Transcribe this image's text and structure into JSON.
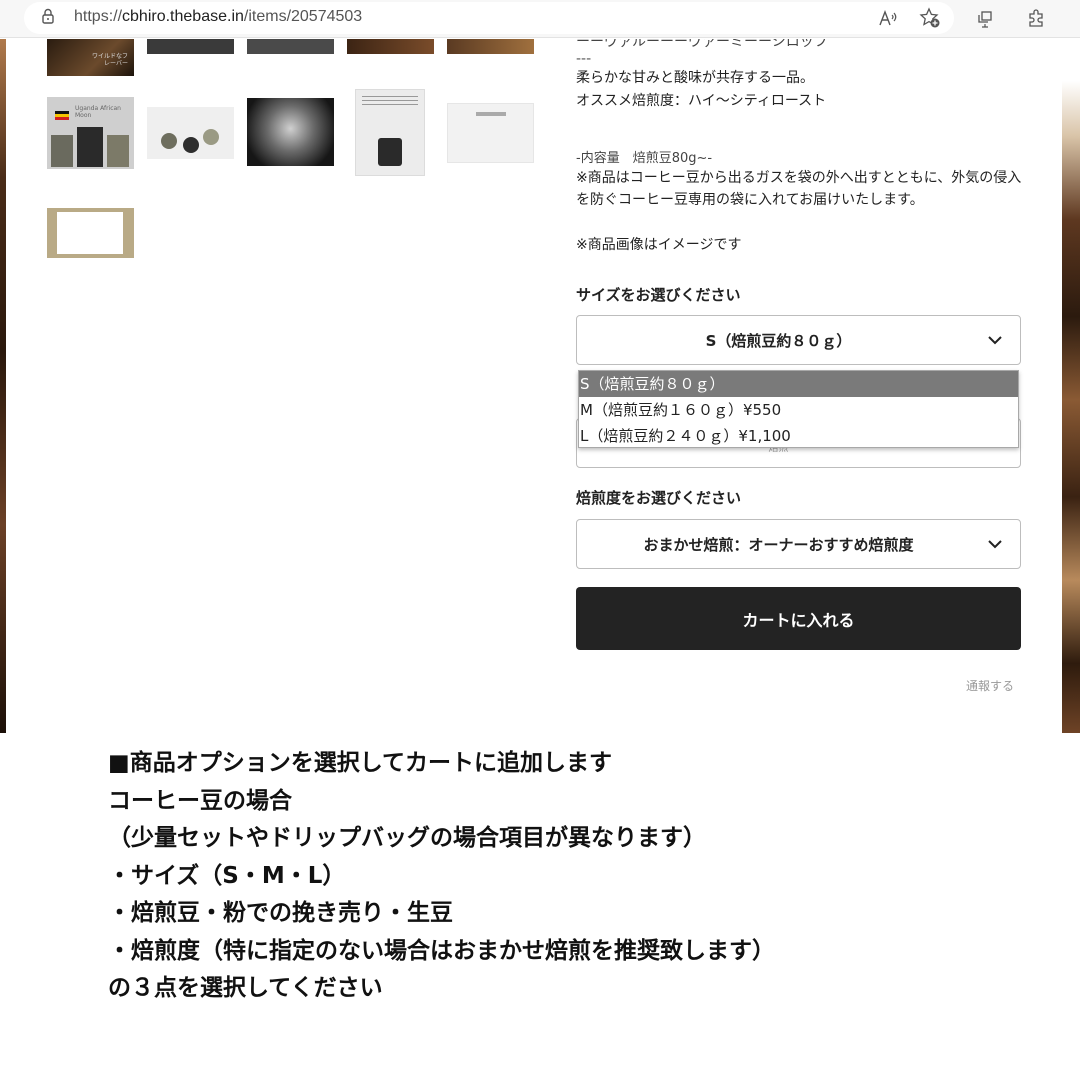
{
  "browser": {
    "url_prefix": "https://",
    "url_host": "cbhiro.thebase.in",
    "url_path": "/items/20574503",
    "icons": [
      "lock-icon",
      "read-aloud-icon",
      "favorite-add-icon",
      "collections-icon",
      "extensions-icon"
    ]
  },
  "thumbnails": {
    "t1_label": "ワイルドなフレーバー",
    "t6_label": "Uganda African Moon"
  },
  "description": {
    "top_line": "ーーヴァルーーーヴァーミーーシロッフ",
    "separator": "---",
    "line1": "柔らかな甘みと酸味が共存する一品。",
    "line2": "オススメ焙煎度：ハイ〜シティロースト",
    "capacity": "-内容量　焙煎豆80g~-",
    "notice": "※商品はコーヒー豆から出るガスを袋の外へ出すとともに、外気の侵入を防ぐコーヒー豆専用の袋に入れてお届けいたします。",
    "image_note": "※商品画像はイメージです"
  },
  "options": {
    "size_label": "サイズをお選びください",
    "size_selected": "S（焙煎豆約８０ｇ）",
    "size_options": [
      "S（焙煎豆約８０ｇ）",
      "M（焙煎豆約１６０ｇ）¥550",
      "L（焙煎豆約２４０ｇ）¥1,100"
    ],
    "grind_partial": "焙煎",
    "roast_label": "焙煎度をお選びください",
    "roast_selected": "おまかせ焙煎：オーナーおすすめ焙煎度"
  },
  "cart": {
    "button_label": "カートに入れる",
    "report_label": "通報する"
  },
  "caption": {
    "lines": [
      "■商品オプションを選択してカートに追加します",
      "コーヒー豆の場合",
      "（少量セットやドリップバッグの場合項目が異なります）",
      "・サイズ（S・M・L）",
      "・焙煎豆・粉での挽き売り・生豆",
      "・焙煎度（特に指定のない場合はおまかせ焙煎を推奨致します）",
      "の３点を選択してください"
    ]
  },
  "colors": {
    "cart_button_bg": "#232323",
    "dropdown_highlight": "#7a7a7a",
    "page_bg": "#ffffff"
  }
}
